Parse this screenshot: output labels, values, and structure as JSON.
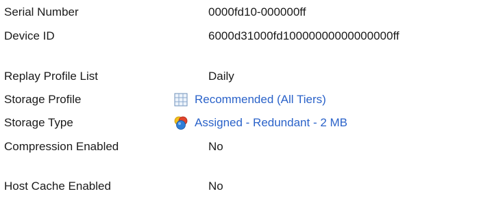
{
  "properties": {
    "serial_number": {
      "label": "Serial Number",
      "value": "0000fd10-000000ff"
    },
    "device_id": {
      "label": "Device ID",
      "value": "6000d31000fd10000000000000000ff"
    },
    "replay_profile_list": {
      "label": "Replay Profile List",
      "value": "Daily"
    },
    "storage_profile": {
      "label": "Storage Profile",
      "value": "Recommended (All Tiers)",
      "icon": "storage-profile-grid-icon"
    },
    "storage_type": {
      "label": "Storage Type",
      "value": "Assigned - Redundant - 2 MB",
      "icon": "storage-type-globe-icon"
    },
    "compression_enabled": {
      "label": "Compression Enabled",
      "value": "No"
    },
    "host_cache_enabled": {
      "label": "Host Cache Enabled",
      "value": "No"
    }
  },
  "colors": {
    "text": "#1a1a1a",
    "link": "#2a62c9",
    "background": "#ffffff"
  }
}
